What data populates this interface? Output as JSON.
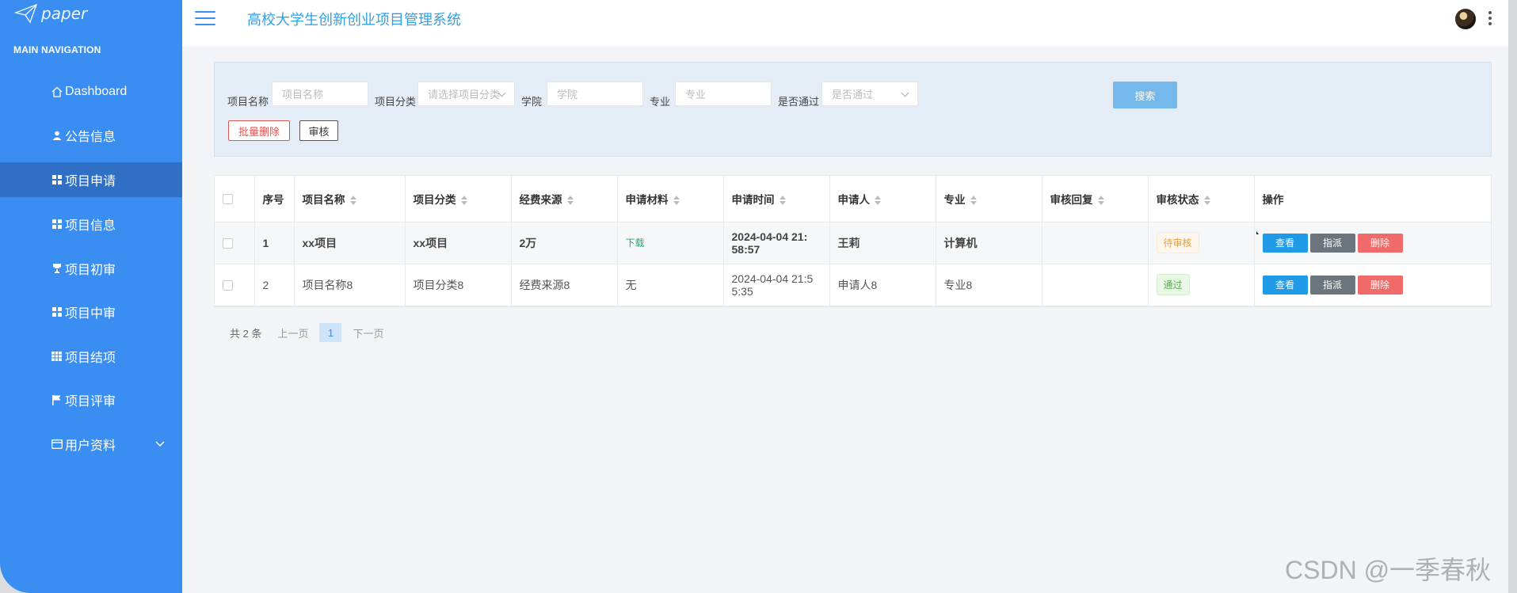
{
  "app": {
    "logo_text": "paper",
    "title": "高校大学生创新创业项目管理系统"
  },
  "sidebar": {
    "heading": "MAIN NAVIGATION",
    "items": [
      {
        "label": "Dashboard",
        "icon": "home-icon"
      },
      {
        "label": "公告信息",
        "icon": "user-icon"
      },
      {
        "label": "项目申请",
        "icon": "grid-icon",
        "active": true
      },
      {
        "label": "项目信息",
        "icon": "grid-icon"
      },
      {
        "label": "项目初审",
        "icon": "trophy-icon"
      },
      {
        "label": "项目中审",
        "icon": "grid-icon"
      },
      {
        "label": "项目结项",
        "icon": "table-icon"
      },
      {
        "label": "项目评审",
        "icon": "flag-icon"
      },
      {
        "label": "用户资料",
        "icon": "card-icon",
        "expandable": true
      }
    ]
  },
  "search": {
    "fields": [
      {
        "label": "项目名称",
        "placeholder": "项目名称"
      },
      {
        "label": "项目分类",
        "placeholder": "请选择项目分类"
      },
      {
        "label": "学院",
        "placeholder": "学院"
      },
      {
        "label": "专业",
        "placeholder": "专业"
      },
      {
        "label": "是否通过",
        "placeholder": "是否通过"
      }
    ],
    "search_button": "搜索",
    "batch_delete": "批量删除",
    "audit_button": "审核"
  },
  "table": {
    "headers": [
      "序号",
      "项目名称",
      "项目分类",
      "经费来源",
      "申请材料",
      "申请时间",
      "申请人",
      "专业",
      "审核回复",
      "审核状态",
      "操作"
    ],
    "rows": [
      {
        "no": "1",
        "name": "xx项目",
        "category": "xx项目",
        "funding": "2万",
        "material": "下载",
        "time_a": "2024-04-04 21:",
        "time_b": "58:57",
        "applicant": "王莉",
        "major": "计算机",
        "reply": "",
        "status": "待审核"
      },
      {
        "no": "2",
        "name": "项目名称8",
        "category": "项目分类8",
        "funding": "经费来源8",
        "material": "无",
        "time_a": "2024-04-04 21:5",
        "time_b": "5:35",
        "applicant": "申请人8",
        "major": "专业8",
        "reply": "",
        "status": "通过"
      }
    ],
    "actions": {
      "view": "查看",
      "assign": "指派",
      "delete": "删除"
    }
  },
  "pagination": {
    "total": "共 2 条",
    "prev": "上一页",
    "current": "1",
    "next": "下一页"
  },
  "watermark": "CSDN @一季春秋",
  "colors": {
    "sidebar": "#3a8ef2",
    "active": "#2f6fc4",
    "title": "#2ea2e8",
    "view": "#1e9ae6",
    "assign": "#6c757d",
    "delete": "#f06a6a"
  }
}
